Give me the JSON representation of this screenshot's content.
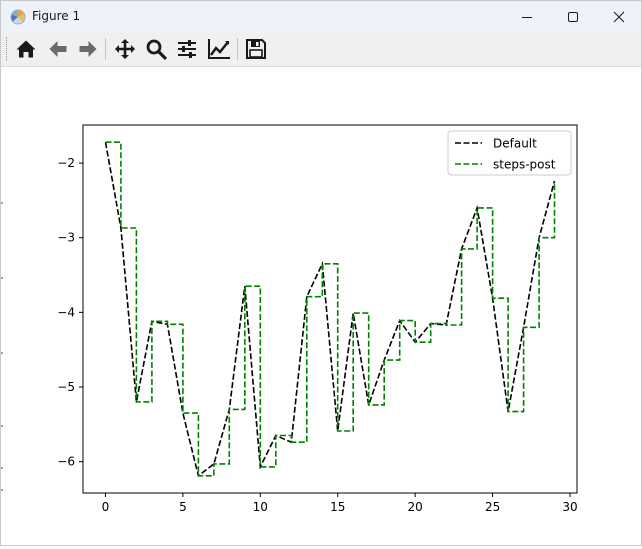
{
  "window": {
    "title": "Figure 1",
    "controls": {
      "minimize": "minimize",
      "maximize": "maximize",
      "close": "close"
    }
  },
  "toolbar": {
    "buttons": [
      {
        "name": "home",
        "icon": "home-icon"
      },
      {
        "name": "back",
        "icon": "arrow-left-icon"
      },
      {
        "name": "forward",
        "icon": "arrow-right-icon"
      },
      {
        "name": "pan",
        "icon": "move-icon"
      },
      {
        "name": "zoom",
        "icon": "magnifier-icon"
      },
      {
        "name": "subplots",
        "icon": "sliders-icon"
      },
      {
        "name": "customize",
        "icon": "line-chart-icon"
      },
      {
        "name": "save",
        "icon": "floppy-disk-icon"
      }
    ]
  },
  "chart_data": {
    "type": "line",
    "x": [
      0,
      1,
      2,
      3,
      4,
      5,
      6,
      7,
      8,
      9,
      10,
      11,
      12,
      13,
      14,
      15,
      16,
      17,
      18,
      19,
      20,
      21,
      22,
      23,
      24,
      25,
      26,
      27,
      28,
      29
    ],
    "series": [
      {
        "name": "Default",
        "color": "#000000",
        "linestyle": "dashed",
        "drawstyle": "default",
        "values": [
          -1.72,
          -2.87,
          -5.2,
          -4.12,
          -4.16,
          -5.35,
          -6.19,
          -6.03,
          -5.3,
          -3.65,
          -6.07,
          -5.65,
          -5.74,
          -3.79,
          -3.35,
          -5.59,
          -4.01,
          -5.24,
          -4.64,
          -4.11,
          -4.4,
          -4.15,
          -4.17,
          -3.15,
          -2.6,
          -3.81,
          -5.33,
          -4.2,
          -3.0,
          -2.24
        ]
      },
      {
        "name": "steps-post",
        "color": "#008000",
        "linestyle": "dashed",
        "drawstyle": "steps-post",
        "values": [
          -1.72,
          -2.87,
          -5.2,
          -4.12,
          -4.16,
          -5.35,
          -6.19,
          -6.03,
          -5.3,
          -3.65,
          -6.07,
          -5.65,
          -5.74,
          -3.79,
          -3.35,
          -5.59,
          -4.01,
          -5.24,
          -4.64,
          -4.11,
          -4.4,
          -4.15,
          -4.17,
          -3.15,
          -2.6,
          -3.81,
          -5.33,
          -4.2,
          -3.0,
          -2.24
        ]
      }
    ],
    "xlim": [
      -1.45,
      30.45
    ],
    "ylim": [
      -6.42,
      -1.49
    ],
    "xticks": [
      0,
      5,
      10,
      15,
      20,
      25,
      30
    ],
    "xtick_labels": [
      "0",
      "5",
      "10",
      "15",
      "20",
      "25",
      "30"
    ],
    "yticks": [
      -6,
      -5,
      -4,
      -3,
      -2
    ],
    "ytick_labels": [
      "−6",
      "−5",
      "−4",
      "−3",
      "−2"
    ],
    "title": "",
    "xlabel": "",
    "ylabel": "",
    "grid": false,
    "legend_position": "upper right"
  }
}
